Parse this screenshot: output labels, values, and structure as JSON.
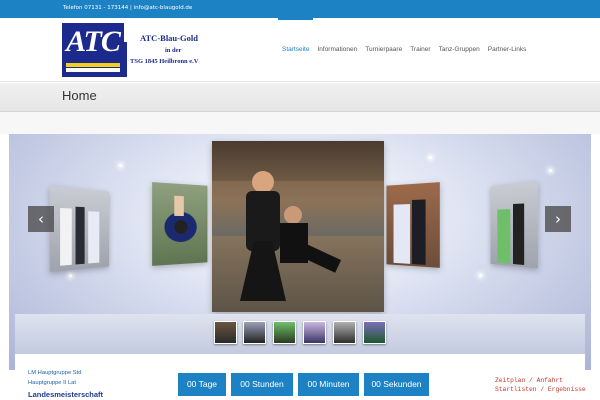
{
  "topbar": {
    "contact": "Telefon 07131 - 173144  |  info@atc-blaugold.de"
  },
  "logo": {
    "mark": "ATC",
    "line1": "ATC-Blau-Gold",
    "line2": "in der",
    "line3": "TSG 1845 Heilbronn e.V"
  },
  "nav": {
    "items": [
      "Startseite",
      "Informationen",
      "Turnierpaare",
      "Trainer",
      "Tanz-Gruppen",
      "Partner-Links"
    ],
    "active": "Startseite"
  },
  "page": {
    "title": "Home"
  },
  "slider": {
    "prev": "‹",
    "next": "›"
  },
  "bottom": {
    "info1": "LM Hauptgruppe Std",
    "info2": "Hauptgruppe II Lat",
    "info3": "Landesmeisterschaft",
    "countdown": [
      "00 Tage",
      "00 Stunden",
      "00 Minuten",
      "00 Sekunden"
    ],
    "links": [
      "Zeitplan / Anfahrt",
      "Startlisten / Ergebnisse"
    ]
  },
  "colors": {
    "accent": "#1d82c3",
    "brand": "#1b2a8c",
    "gold": "#f3d11b",
    "link_red": "#c0392b"
  }
}
